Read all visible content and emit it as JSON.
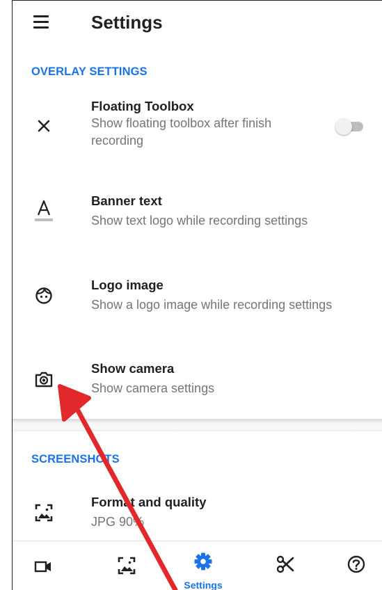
{
  "app_bar": {
    "title": "Settings",
    "menu_icon": "hamburger-menu-icon"
  },
  "sections": {
    "overlay": {
      "header": "OVERLAY SETTINGS"
    },
    "screenshots": {
      "header": "SCREENSHOTS"
    }
  },
  "overlay_items": [
    {
      "icon": "close-icon",
      "label": "Floating Toolbox",
      "description_line1": "Show floating toolbox after finish",
      "description_line2": "recording",
      "toggle_on": false
    },
    {
      "icon": "text-format-icon",
      "label": "Banner text",
      "description": "Show text logo while recording settings"
    },
    {
      "icon": "face-icon",
      "label": "Logo image",
      "description": "Show a logo image while recording settings"
    },
    {
      "icon": "camera-icon",
      "label": "Show camera",
      "description": "Show camera settings"
    }
  ],
  "screenshot_items": [
    {
      "icon": "image-icon",
      "label": "Format and quality",
      "description": "JPG 90%"
    }
  ],
  "bottom_nav": {
    "items": [
      {
        "icon": "video-camera-icon",
        "label": ""
      },
      {
        "icon": "image-icon",
        "label": ""
      },
      {
        "icon": "settings-gear-icon",
        "label": "Settings",
        "active": true
      },
      {
        "icon": "scissors-icon",
        "label": ""
      },
      {
        "icon": "help-icon",
        "label": ""
      }
    ]
  },
  "colors": {
    "accent": "#1a73e8",
    "annotation_arrow": "#e3282b",
    "text_primary": "#212121",
    "text_secondary": "#757575"
  }
}
